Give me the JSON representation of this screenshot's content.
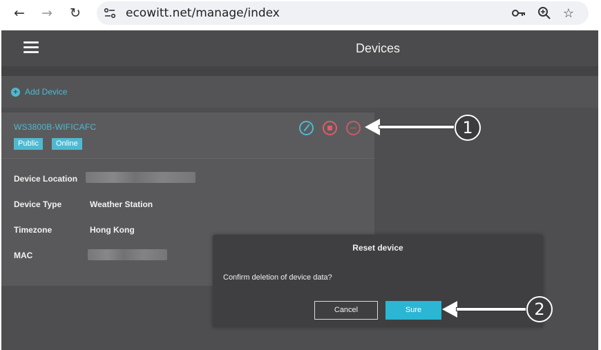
{
  "browser": {
    "back_icon": "←",
    "forward_icon": "→",
    "reload_icon": "↻",
    "url": "ecowitt.net/manage/index",
    "search_icon": "🔍︎",
    "star_icon": "☆"
  },
  "header": {
    "title": "Devices"
  },
  "toolbar": {
    "add_icon": "+",
    "add_label": "Add Device"
  },
  "device": {
    "name": "WS3800B-WIFICAFC",
    "tags": [
      "Public",
      "Online"
    ],
    "details": [
      {
        "label": "Device Location",
        "value": ""
      },
      {
        "label": "Device Type",
        "value": "Weather Station"
      },
      {
        "label": "Timezone",
        "value": "Hong Kong"
      },
      {
        "label": "MAC",
        "value": ""
      }
    ]
  },
  "modal": {
    "title": "Reset device",
    "message": "Confirm deletion of device data?",
    "cancel_label": "Cancel",
    "confirm_label": "Sure"
  },
  "annotations": {
    "step1": "1",
    "step2": "2"
  },
  "colors": {
    "accent": "#4fb9d1",
    "danger": "#e05c68",
    "confirm": "#2bb6d4",
    "panel": "#4e4e50"
  }
}
